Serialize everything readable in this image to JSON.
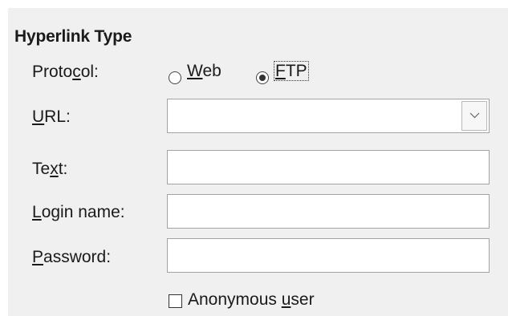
{
  "section": {
    "title": "Hyperlink Type"
  },
  "protocol": {
    "label_pre": "Proto",
    "label_key": "c",
    "label_post": "ol:",
    "options": [
      {
        "key": "W",
        "rest": "eb",
        "checked": false
      },
      {
        "key": "F",
        "rest": "TP",
        "checked": true
      }
    ]
  },
  "url": {
    "label_key": "U",
    "label_rest": "RL:",
    "value": "",
    "placeholder": ""
  },
  "text": {
    "label_pre": "Te",
    "label_key": "x",
    "label_post": "t:",
    "value": ""
  },
  "login": {
    "label_key": "L",
    "label_rest": "ogin name:",
    "value": ""
  },
  "password": {
    "label_key": "P",
    "label_rest": "assword:",
    "value": ""
  },
  "anonymous": {
    "label_pre": "Anonymous ",
    "label_key": "u",
    "label_post": "ser",
    "checked": false
  }
}
